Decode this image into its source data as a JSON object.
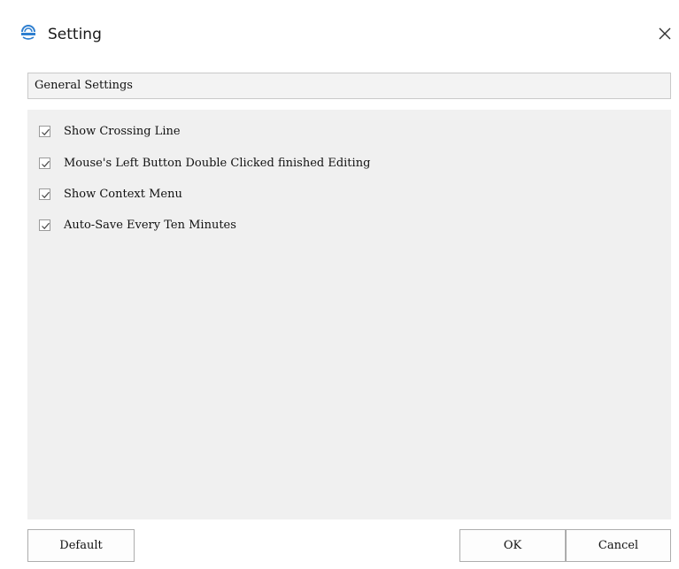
{
  "window": {
    "title": "Setting",
    "close_glyph": "×"
  },
  "section": {
    "title": "General Settings"
  },
  "options": [
    {
      "label": "Show Crossing Line",
      "checked": true
    },
    {
      "label": "Mouse's Left Button Double Clicked finished Editing",
      "checked": true
    },
    {
      "label": "Show Context Menu",
      "checked": true
    },
    {
      "label": "Auto-Save Every Ten Minutes",
      "checked": true
    }
  ],
  "footer": {
    "default_label": "Default",
    "ok_label": "OK",
    "cancel_label": "Cancel"
  },
  "icons": {
    "app": "app-logo-icon",
    "close": "close-icon",
    "check": "checkmark-icon"
  },
  "colors": {
    "panel_bg": "#f0f0f0",
    "header_bg": "#f3f3f3",
    "border": "#adadad",
    "check": "#4a4a4a"
  }
}
